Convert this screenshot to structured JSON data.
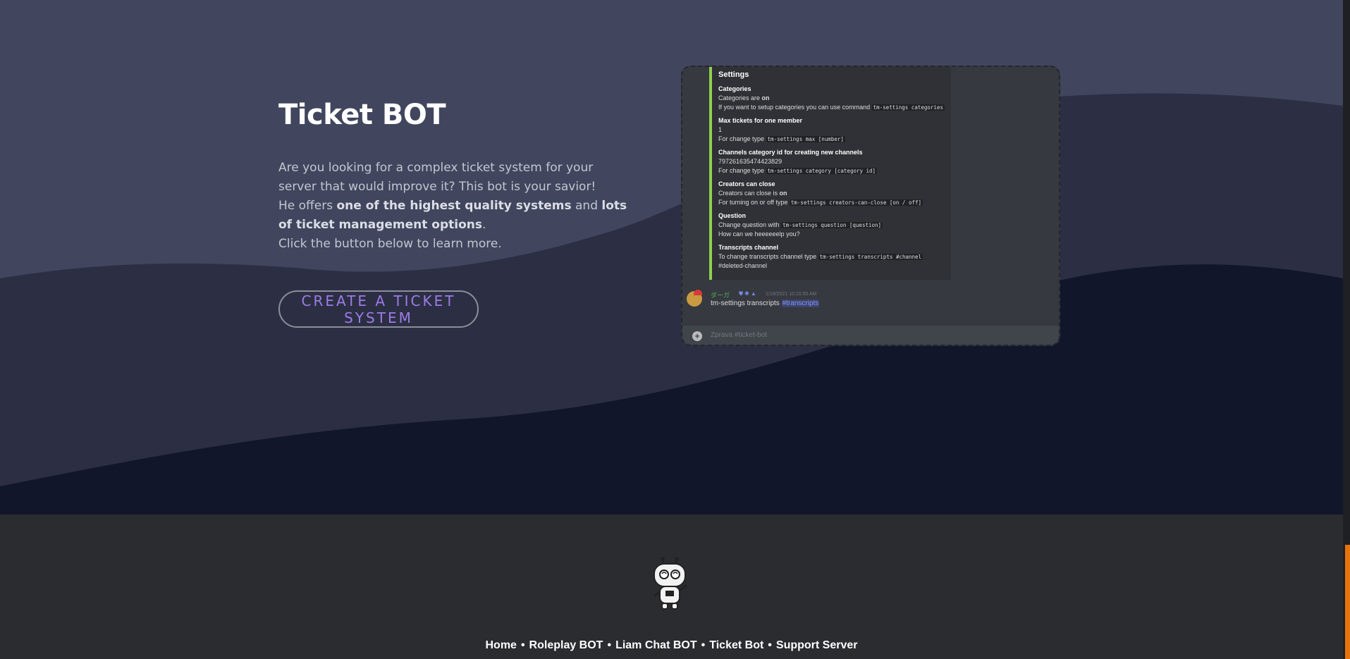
{
  "hero": {
    "title": "Ticket BOT",
    "desc_line1": "Are you looking for a complex ticket system for your server that would improve it? This bot is your savior!",
    "desc_he_offers": "He offers ",
    "desc_bold1": "one of the highest quality systems",
    "desc_and": " and ",
    "desc_bold2": "lots of ticket management options",
    "desc_period": ".",
    "desc_line3": "Click the button below to learn more.",
    "cta_label": "CREATE A TICKET SYSTEM",
    "colors": {
      "background": "#41465e",
      "wave_mid": "#2c2f44",
      "wave_dark": "#12162b",
      "cta_text": "#9c7ce6"
    }
  },
  "screenshot": {
    "embed": {
      "title": "Settings",
      "blocks": [
        {
          "head": "Categories",
          "l1_pre": "Categories are ",
          "l1_bold": "on",
          "l2_pre": "If you want to setup categories you can use command ",
          "l2_code": "tm-settings categories"
        },
        {
          "head": "Max tickets for one member",
          "l1": "1",
          "l2_pre": "For change type ",
          "l2_code": "tm-settings max [number]"
        },
        {
          "head": "Channels category id for creating new channels",
          "l1": "797261635474423829",
          "l2_pre": "For change type ",
          "l2_code": "tm-settings category [category id]"
        },
        {
          "head": "Creators can close",
          "l1_pre": "Creators can close is ",
          "l1_bold": "on",
          "l2_pre": "For turning on or off type ",
          "l2_code": "tm-settings creators-can-close [on / off]"
        },
        {
          "head": "Question",
          "l1_pre": "Change question with ",
          "l1_code": "tm-settings question [question]",
          "l2": "How can we heeeeeelp you?"
        },
        {
          "head": "Transcripts channel",
          "l1_pre": "To change transcripts channel type ",
          "l1_code": "tm-settings transcripts #channel",
          "l2": "#deleted-channel"
        }
      ]
    },
    "message": {
      "username": "ダーガ",
      "timestamp": "1/18/2021 10:15:50 AM",
      "text_pre": "tm-settings transcripts ",
      "mention": "#transcripts"
    },
    "input_placeholder": "Zprava #ticket-bot"
  },
  "footer": {
    "links": [
      "Home",
      "Roleplay BOT",
      "Liam Chat BOT",
      "Ticket Bot",
      "Support Server"
    ],
    "separator": "•"
  }
}
